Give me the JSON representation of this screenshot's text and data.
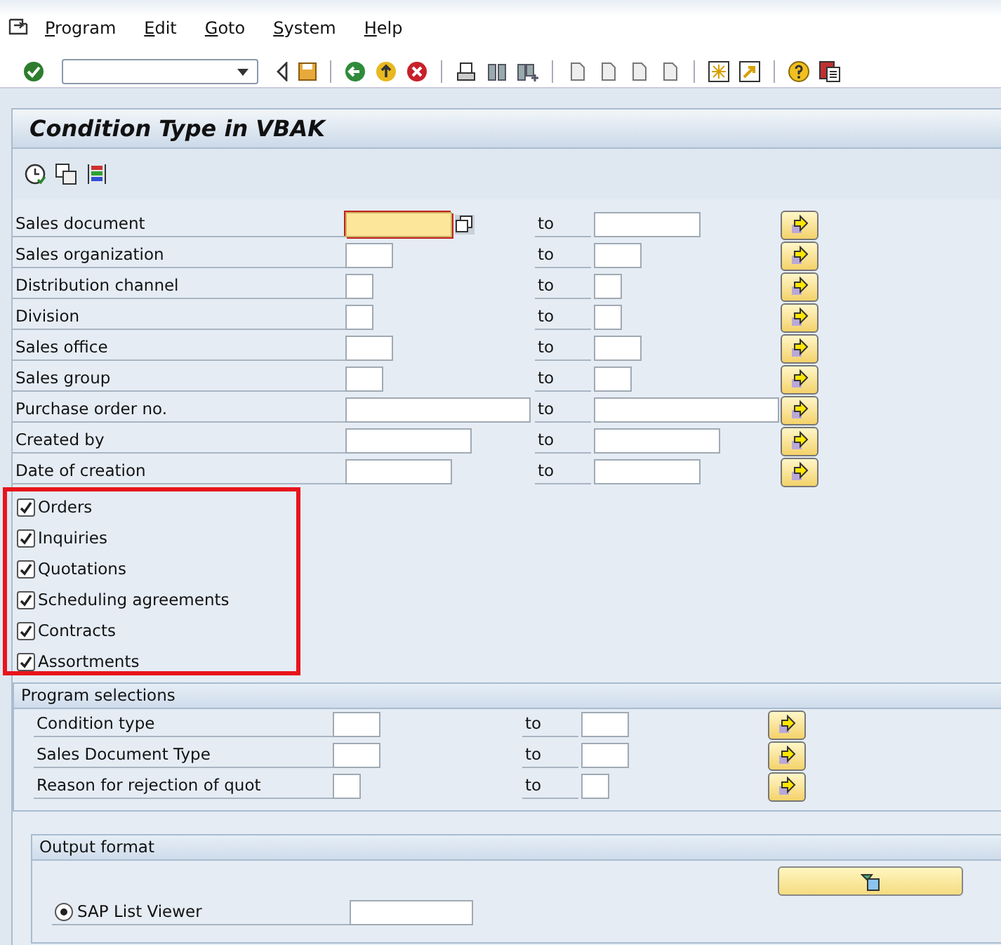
{
  "menu": [
    "Program",
    "Edit",
    "Goto",
    "System",
    "Help"
  ],
  "title": "Condition Type in VBAK",
  "ranges": [
    {
      "label": "Sales document",
      "to": "to",
      "focused": true
    },
    {
      "label": "Sales organization",
      "to": "to",
      "focused": false
    },
    {
      "label": "Distribution channel",
      "to": "to",
      "focused": false
    },
    {
      "label": "Division",
      "to": "to",
      "focused": false
    },
    {
      "label": "Sales office",
      "to": "to",
      "focused": false
    },
    {
      "label": "Sales group",
      "to": "to",
      "focused": false
    },
    {
      "label": "Purchase order no.",
      "to": "to",
      "focused": false
    },
    {
      "label": "Created by",
      "to": "to",
      "focused": false
    },
    {
      "label": "Date of creation",
      "to": "to",
      "focused": false
    }
  ],
  "document_types": [
    {
      "label": "Orders",
      "checked": true
    },
    {
      "label": "Inquiries",
      "checked": true
    },
    {
      "label": "Quotations",
      "checked": true
    },
    {
      "label": "Scheduling agreements",
      "checked": true
    },
    {
      "label": "Contracts",
      "checked": true
    },
    {
      "label": "Assortments",
      "checked": true
    }
  ],
  "program_selections": {
    "title": "Program selections",
    "rows": [
      {
        "label": "Condition type",
        "to": "to"
      },
      {
        "label": "Sales Document Type",
        "to": "to"
      },
      {
        "label": "Reason for rejection of quot",
        "to": "to"
      }
    ]
  },
  "output_format": {
    "title": "Output format",
    "options": [
      {
        "label": "SAP List Viewer",
        "selected": true
      }
    ]
  }
}
